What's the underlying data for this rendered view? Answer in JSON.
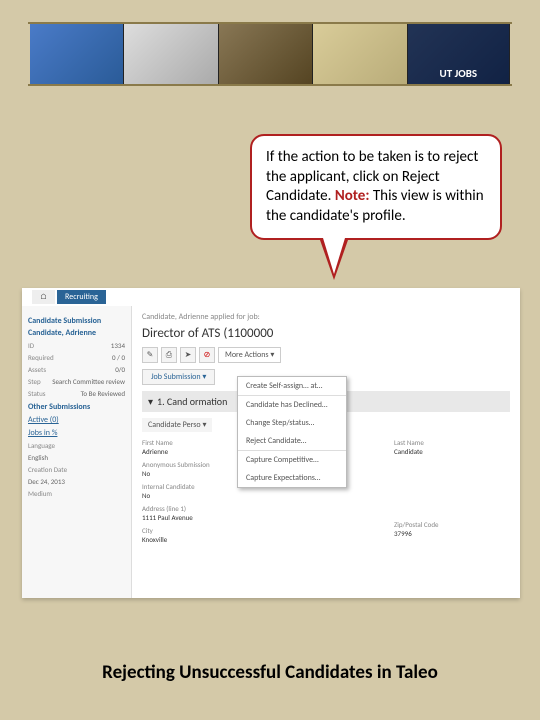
{
  "banner": {
    "logo": "UT JOBS"
  },
  "callout": {
    "text_pre": "If the action to be taken is to reject the applicant, click on Reject Candidate. ",
    "note_label": "Note:",
    "text_post": " This view is within the candidate's profile."
  },
  "screenshot": {
    "tabs": {
      "home": "⌂",
      "active": "Recruiting"
    },
    "breadcrumb": "Candidate, Adrienne applied for job:",
    "title": "Director of ATS (1100000",
    "sidebar": {
      "header": "Candidate Submission",
      "name": "Candidate, Adrienne",
      "rows": [
        {
          "label": "ID",
          "value": "1334"
        },
        {
          "label": "Required",
          "value": "0 / 0"
        },
        {
          "label": "Assets",
          "value": "0/0"
        },
        {
          "label": "Step",
          "value": "Search Committee review"
        },
        {
          "label": "Status",
          "value": "To Be Reviewed"
        }
      ],
      "other_sub": "Other Submissions",
      "active_link": "Active (0)",
      "jobs_link": "Jobs in %",
      "lang_label": "Language",
      "lang_value": "English",
      "date_label": "Creation Date",
      "date_value": "Dec 24, 2013",
      "medium_label": "Medium"
    },
    "toolbar": {
      "more_actions": "More Actions ▾"
    },
    "subtab": "Job Submission ▾",
    "dropdown": [
      "Create Self-assign… at…",
      "Candidate has Declined…",
      "Change Step/status…",
      "Reject Candidate…",
      "Capture Competitive…",
      "Capture Expectations…"
    ],
    "section": {
      "title": "1. Cand                               ormation",
      "subtitle": "Candidate Perso ▾"
    },
    "form": {
      "first_name_label": "First Name",
      "first_name": "Adrienne",
      "last_name_label": "Last Name",
      "last_name": "Candidate",
      "submission_label": "Anonymous Submission",
      "submission": "No",
      "internal_label": "Internal Candidate",
      "internal": "No",
      "address_label": "Address (line 1)",
      "address": "1111 Paul Avenue",
      "city_label": "City",
      "city": "Knoxville",
      "zip_label": "Zip/Postal Code",
      "zip": "37996"
    }
  },
  "caption": "Rejecting Unsuccessful Candidates in Taleo"
}
